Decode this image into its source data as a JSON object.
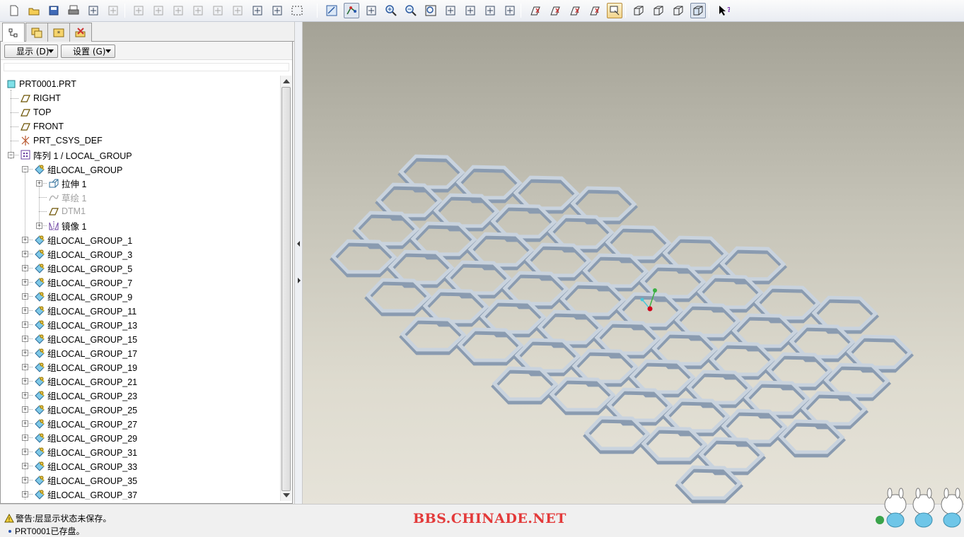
{
  "toolbar": {
    "buttons": [
      "new-file-icon",
      "open-file-icon",
      "save-icon",
      "print-icon",
      "page-setup-icon",
      "close-window-icon",
      "undo-icon",
      "redo-icon",
      "cut-icon",
      "copy-icon",
      "paste-icon",
      "paste-special-icon",
      "regenerate-icon",
      "find-icon",
      "select-box-icon",
      "refit-icon",
      "spin-center-icon",
      "orient-mode-icon",
      "zoom-in-icon",
      "zoom-out-icon",
      "zoom-fit-icon",
      "reorient-icon",
      "saved-views-icon",
      "layers-icon",
      "view-manager-icon",
      "datum-planes-icon",
      "datum-axes-icon",
      "datum-points-icon",
      "coordinate-systems-icon",
      "annotation-display-icon",
      "wireframe-icon",
      "hidden-line-icon",
      "no-hidden-icon",
      "shading-icon",
      "context-help-icon"
    ]
  },
  "panel": {
    "show_label": "显示 (D)",
    "settings_label": "设置 (G)"
  },
  "tree": {
    "root": "PRT0001.PRT",
    "items": [
      {
        "label": "RIGHT",
        "icon": "datum-plane-icon"
      },
      {
        "label": "TOP",
        "icon": "datum-plane-icon"
      },
      {
        "label": "FRONT",
        "icon": "datum-plane-icon"
      },
      {
        "label": "PRT_CSYS_DEF",
        "icon": "coordinate-system-icon"
      },
      {
        "label": "阵列 1 / LOCAL_GROUP",
        "icon": "pattern-icon"
      },
      {
        "label": "组LOCAL_GROUP",
        "icon": "group-icon"
      },
      {
        "label": "拉伸 1",
        "icon": "extrude-icon"
      },
      {
        "label": "草绘 1",
        "icon": "sketch-icon"
      },
      {
        "label": "DTM1",
        "icon": "datum-plane-icon"
      },
      {
        "label": "镜像 1",
        "icon": "mirror-icon"
      }
    ],
    "groups": [
      "组LOCAL_GROUP_1",
      "组LOCAL_GROUP_3",
      "组LOCAL_GROUP_5",
      "组LOCAL_GROUP_7",
      "组LOCAL_GROUP_9",
      "组LOCAL_GROUP_11",
      "组LOCAL_GROUP_13",
      "组LOCAL_GROUP_15",
      "组LOCAL_GROUP_17",
      "组LOCAL_GROUP_19",
      "组LOCAL_GROUP_21",
      "组LOCAL_GROUP_23",
      "组LOCAL_GROUP_25",
      "组LOCAL_GROUP_27",
      "组LOCAL_GROUP_29",
      "组LOCAL_GROUP_31",
      "组LOCAL_GROUP_33",
      "组LOCAL_GROUP_35",
      "组LOCAL_GROUP_37"
    ]
  },
  "status": {
    "warning": "警告:层显示状态未保存。",
    "saved": "PRT0001已存盘。",
    "watermark": "BBS.CHINADE.NET"
  },
  "colors": {
    "accent_active": "#f2d58d",
    "model_face": "#8a9bb0",
    "model_top": "#c9d3de",
    "csys_red": "#d0021b",
    "csys_green": "#3cb043",
    "csys_cyan": "#49c7d8"
  }
}
